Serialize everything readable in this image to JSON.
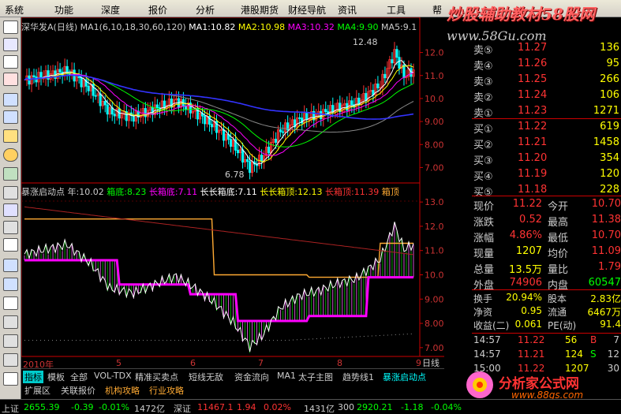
{
  "menu": [
    "系统",
    "功能",
    "深度",
    "报价",
    "分析",
    "港股期货",
    "财经导航",
    "资讯",
    "工具",
    "帮"
  ],
  "brand": {
    "line1": "炒股辅助教材58股网",
    "line2": "www.58Gu.com"
  },
  "chart": {
    "title": "深华发A(日线)",
    "ma_params": "MA1(6,10,18,30,60,120)",
    "ma1": "MA1:10.82",
    "ma2": "MA2:10.98",
    "ma3": "MA3:10.32",
    "ma4": "MA4:9.90",
    "ma5": "MA5:9.1",
    "price_ticks": [
      "12.00",
      "11.00",
      "10.00",
      "9.00",
      "8.00",
      "7.00"
    ],
    "high_label": "12.48",
    "low_label": "6.78",
    "indicator": {
      "name": "暴涨启动点",
      "year": "年:10.02",
      "box_bottom": "箱底:8.23",
      "long_bottom": "长箱底:7.11",
      "long_long_bottom": "长长箱底:7.11",
      "long_long_top": "长长箱顶:12.13",
      "long_top": "长箱顶:11.39",
      "top": "箱顶"
    },
    "ind_ticks": [
      "13.00",
      "12.00",
      "11.00",
      "10.00",
      "9.00",
      "8.00",
      "7.00"
    ],
    "x_labels": [
      "2010年",
      "5",
      "6",
      "7",
      "8",
      "9"
    ],
    "day_tag": "日线"
  },
  "chart_data": {
    "type": "line",
    "x": [
      "2010-04",
      "2010-05",
      "2010-06",
      "2010-07",
      "2010-08",
      "2010-09"
    ],
    "series": [
      {
        "name": "MA1",
        "values": [
          10.6,
          10.2,
          8.8,
          7.6,
          9.2,
          10.8
        ]
      }
    ],
    "ylim": [
      6.5,
      12.7
    ]
  },
  "tabs": [
    "指标",
    "模板",
    "全部",
    "VOL-TDX",
    "精准买卖点",
    "短线无敌",
    "资金流向",
    "MA1",
    "太子主图",
    "趋势线1",
    "暴涨启动点"
  ],
  "tabs2": [
    "扩展区",
    "关联报价",
    "机构攻略",
    "行业攻略"
  ],
  "quotes": {
    "sell": [
      {
        "l": "卖⑤",
        "p": "11.27",
        "v": "136"
      },
      {
        "l": "卖④",
        "p": "11.26",
        "v": "95"
      },
      {
        "l": "卖③",
        "p": "11.25",
        "v": "266"
      },
      {
        "l": "卖②",
        "p": "11.24",
        "v": "106"
      },
      {
        "l": "卖①",
        "p": "11.23",
        "v": "1271"
      }
    ],
    "buy": [
      {
        "l": "买①",
        "p": "11.22",
        "v": "619"
      },
      {
        "l": "买②",
        "p": "11.21",
        "v": "1458"
      },
      {
        "l": "买③",
        "p": "11.20",
        "v": "354"
      },
      {
        "l": "买④",
        "p": "11.19",
        "v": "120"
      },
      {
        "l": "买⑤",
        "p": "11.18",
        "v": "228"
      }
    ],
    "stats": [
      {
        "a": "现价",
        "av": "11.22",
        "b": "今开",
        "bv": "10.70"
      },
      {
        "a": "涨跌",
        "av": "0.52",
        "b": "最高",
        "bv": "11.38"
      },
      {
        "a": "涨幅",
        "av": "4.86%",
        "b": "最低",
        "bv": "10.70"
      },
      {
        "a": "现量",
        "av": "1207",
        "b": "均价",
        "bv": "11.09"
      },
      {
        "a": "总量",
        "av": "13.5万",
        "b": "量比",
        "bv": "1.79"
      },
      {
        "a": "外盘",
        "av": "74906",
        "b": "内盘",
        "bv": "60547"
      }
    ],
    "stats2": [
      {
        "a": "换手",
        "av": "20.94%",
        "b": "股本",
        "bv": "2.83亿"
      },
      {
        "a": "净资",
        "av": "0.95",
        "b": "流通",
        "bv": "6467万"
      },
      {
        "a": "收益(二)",
        "av": "0.061",
        "b": "PE(动)",
        "bv": "91.4"
      }
    ],
    "ticks": [
      {
        "t": "14:57",
        "p": "11.22",
        "v": "56",
        "s": "B",
        "n": "7"
      },
      {
        "t": "14:57",
        "p": "11.21",
        "v": "124",
        "s": "S",
        "n": "12"
      },
      {
        "t": "15:00",
        "p": "11.22",
        "v": "1207",
        "s": "",
        "n": "30"
      }
    ]
  },
  "status": {
    "sh_label": "上证",
    "sh_val": "2655.39",
    "sh_chg": "-0.39",
    "sh_pct": "-0.01%",
    "sh_amt": "1472亿",
    "sz_label": "深证",
    "sz_val": "11467.1",
    "sz_chg": "1.94",
    "sz_pct": "0.02%",
    "sz_amt": "1431亿",
    "hs_label": "300",
    "hs_val": "2920.21",
    "hs_chg": "-1.18",
    "hs_pct": "-0.04%"
  },
  "logo": {
    "text": "分析家公式网",
    "url": "www.88gs.com"
  }
}
